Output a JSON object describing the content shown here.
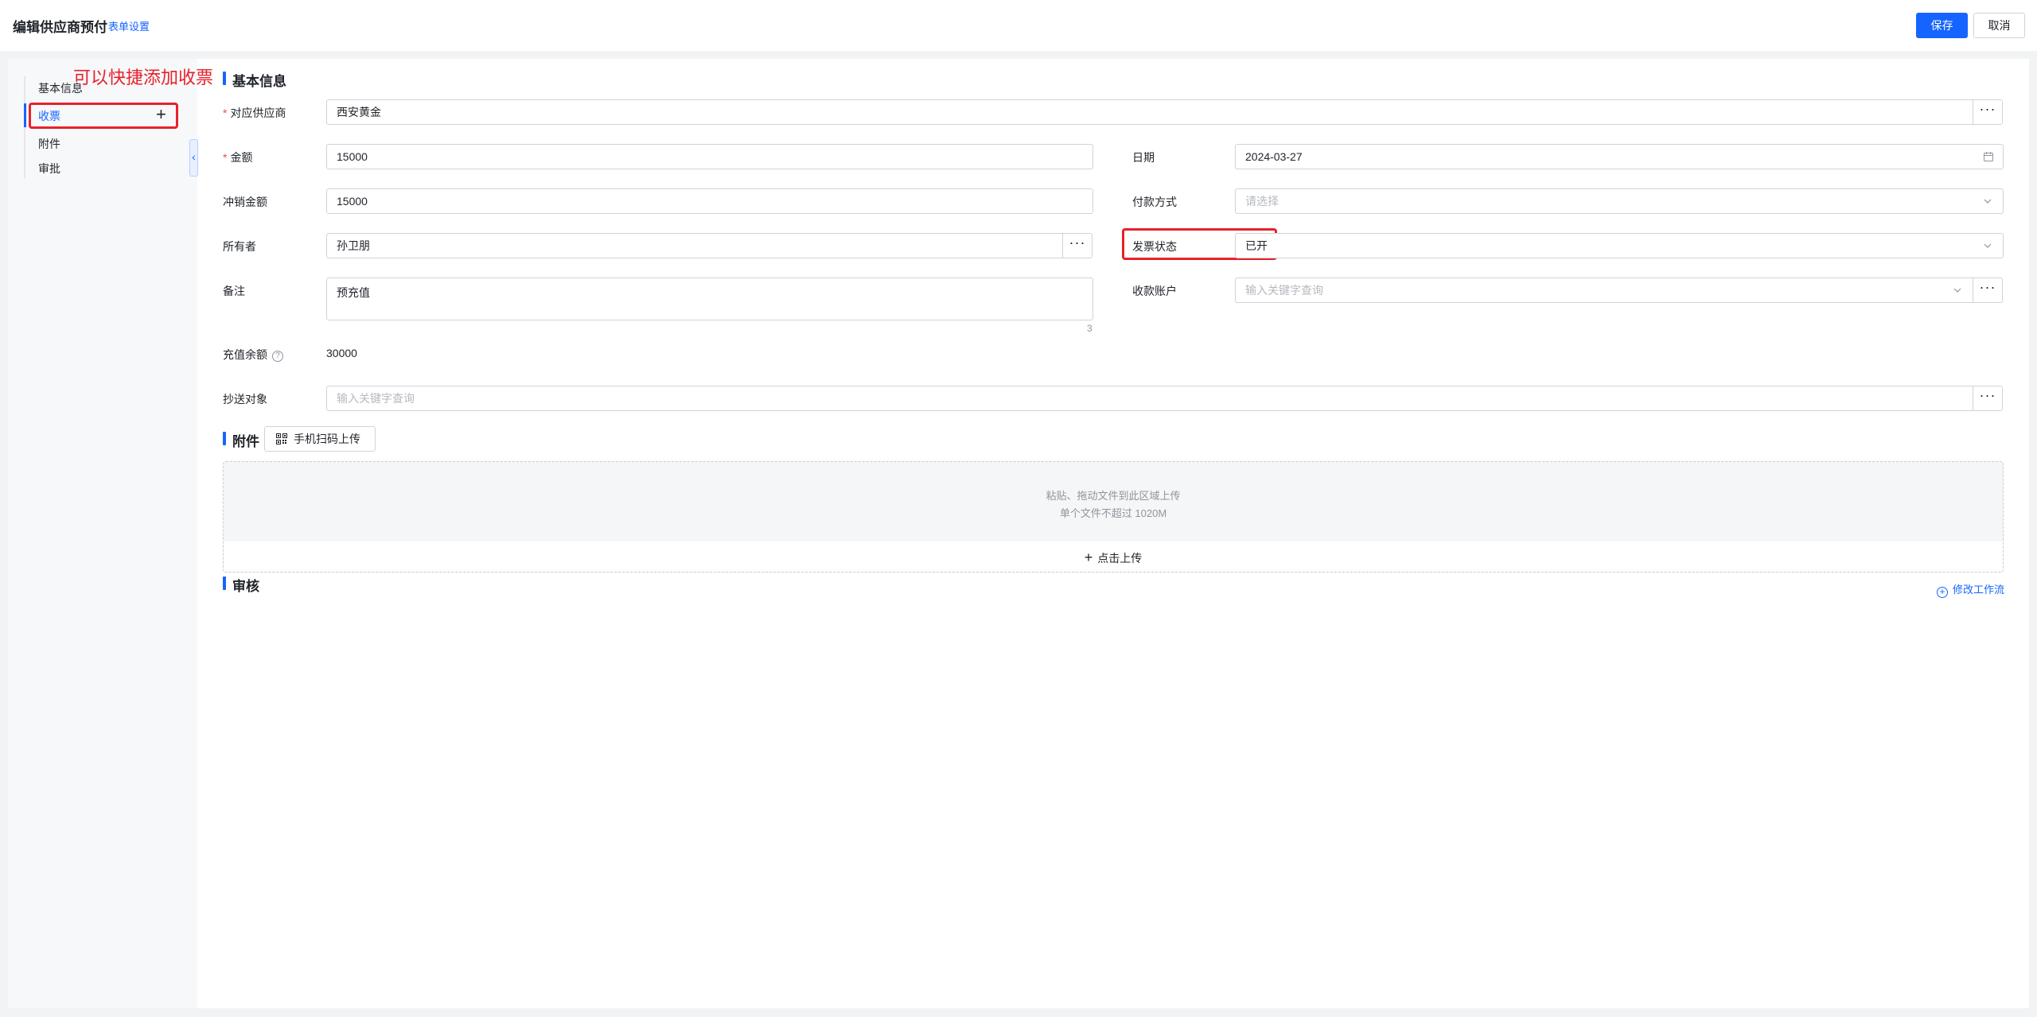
{
  "header": {
    "title": "编辑供应商预付",
    "form_settings": "表单设置",
    "save_label": "保存",
    "cancel_label": "取消"
  },
  "annotation": {
    "text": "可以快捷添加收票",
    "color": "#e8212a"
  },
  "nav": {
    "items": [
      {
        "label": "基本信息",
        "active": false
      },
      {
        "label": "收票",
        "active": true
      },
      {
        "label": "附件",
        "active": false
      },
      {
        "label": "审批",
        "active": false
      }
    ],
    "add_icon": "plus-icon",
    "collapse_icon": "chevron-left-icon"
  },
  "basic": {
    "title": "基本信息",
    "supplier": {
      "label": "对应供应商",
      "value": "西安黄金"
    },
    "amount": {
      "label": "金额",
      "value": "15000"
    },
    "date": {
      "label": "日期",
      "value": "2024-03-27"
    },
    "offset_amount": {
      "label": "冲销金额",
      "value": "15000"
    },
    "payment_method": {
      "label": "付款方式",
      "placeholder": "请选择"
    },
    "owner": {
      "label": "所有者",
      "value": "孙卫朋"
    },
    "invoice_status": {
      "label": "发票状态",
      "value": "已开"
    },
    "remark": {
      "label": "备注",
      "value": "预充值",
      "count": "3"
    },
    "receiving_account": {
      "label": "收款账户",
      "placeholder": "输入关键字查询"
    },
    "balance": {
      "label": "充值余额",
      "value": "30000"
    },
    "cc": {
      "label": "抄送对象",
      "placeholder": "输入关键字查询"
    }
  },
  "attachment": {
    "title": "附件",
    "scan_upload": "手机扫码上传",
    "hint1": "粘贴、拖动文件到此区域上传",
    "hint2": "单个文件不超过 1020M",
    "click_upload": "点击上传"
  },
  "review": {
    "title": "审核",
    "modify_flow": "修改工作流"
  },
  "colors": {
    "primary": "#1664ff",
    "required": "#f54a45"
  }
}
